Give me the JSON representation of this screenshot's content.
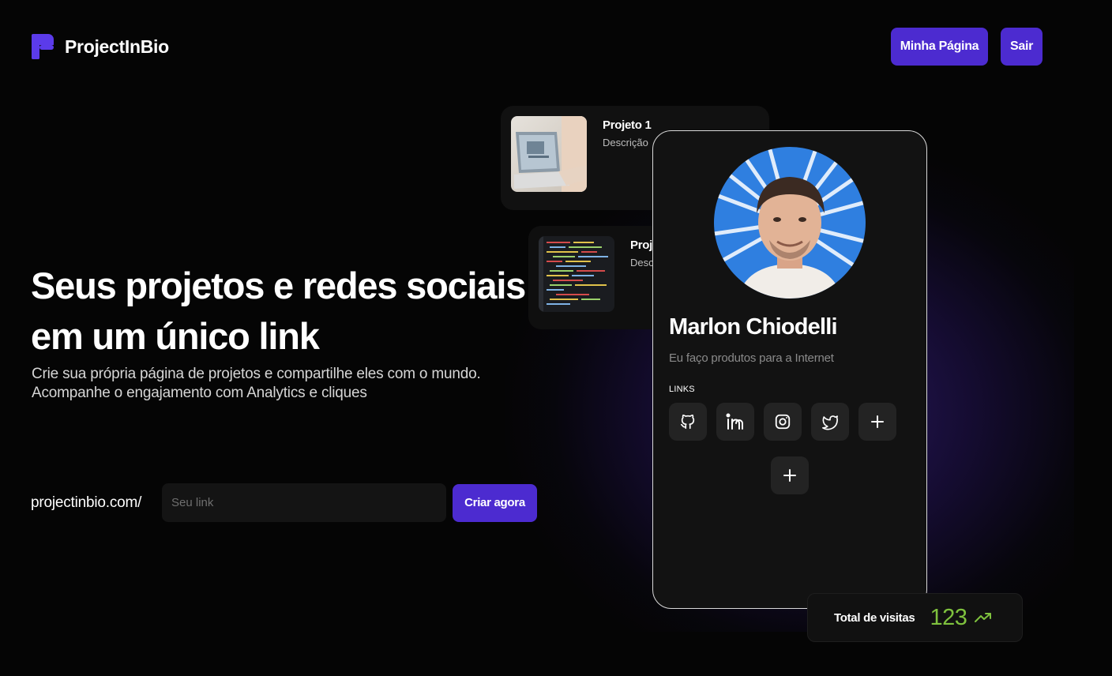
{
  "header": {
    "brand": "ProjectInBio",
    "minha_pagina_label": "Minha Página",
    "sair_label": "Sair"
  },
  "hero": {
    "title_line1": "Seus projetos e redes sociais",
    "title_line2": "em um único link",
    "subtitle_line1": "Crie sua própria página de projetos e compartilhe eles com o mundo.",
    "subtitle_line2": "Acompanhe o engajamento com Analytics e cliques",
    "link_prefix": "projectinbio.com/",
    "link_placeholder": "Seu link",
    "link_value": "",
    "cta_label": "Criar agora"
  },
  "projects": [
    {
      "name": "Projeto 1",
      "description": "Descrição",
      "thumb": "laptop-photo"
    },
    {
      "name": "Proj",
      "description": "Desc",
      "thumb": "code-screen-photo"
    }
  ],
  "profile": {
    "name": "Marlon Chiodelli",
    "bio": "Eu faço produtos para a Internet",
    "links_label": "LINKS",
    "links": [
      {
        "icon": "github-icon"
      },
      {
        "icon": "linkedin-icon"
      },
      {
        "icon": "instagram-icon"
      },
      {
        "icon": "twitter-icon"
      },
      {
        "icon": "plus-icon"
      }
    ],
    "add_project_icon": "plus-icon"
  },
  "stats": {
    "label": "Total de visitas",
    "value": "123",
    "trend_icon": "trending-up-icon"
  },
  "colors": {
    "background": "#050505",
    "accent": "#4c2bd0",
    "card": "#121212",
    "stat_green": "#7fc23e"
  }
}
